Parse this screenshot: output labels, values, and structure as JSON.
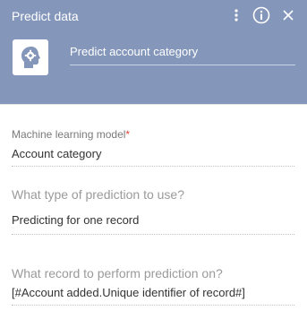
{
  "header": {
    "title": "Predict data",
    "name": "Predict account category",
    "icons": [
      "more-icon",
      "info-icon",
      "close-icon"
    ],
    "color": "#8497bb"
  },
  "fields": {
    "model": {
      "label": "Machine learning model",
      "required_mark": "*",
      "value": "Account category"
    },
    "prediction_type": {
      "label": "What type of prediction to use?",
      "value": "Predicting for one record"
    },
    "record": {
      "label": "What record to perform prediction on?",
      "value": "[#Account added.Unique identifier of record#]"
    }
  },
  "colors": {
    "required": "#e5453a",
    "icon_tile_bg": "#ffffff",
    "icon_fg": "#8497bb"
  }
}
